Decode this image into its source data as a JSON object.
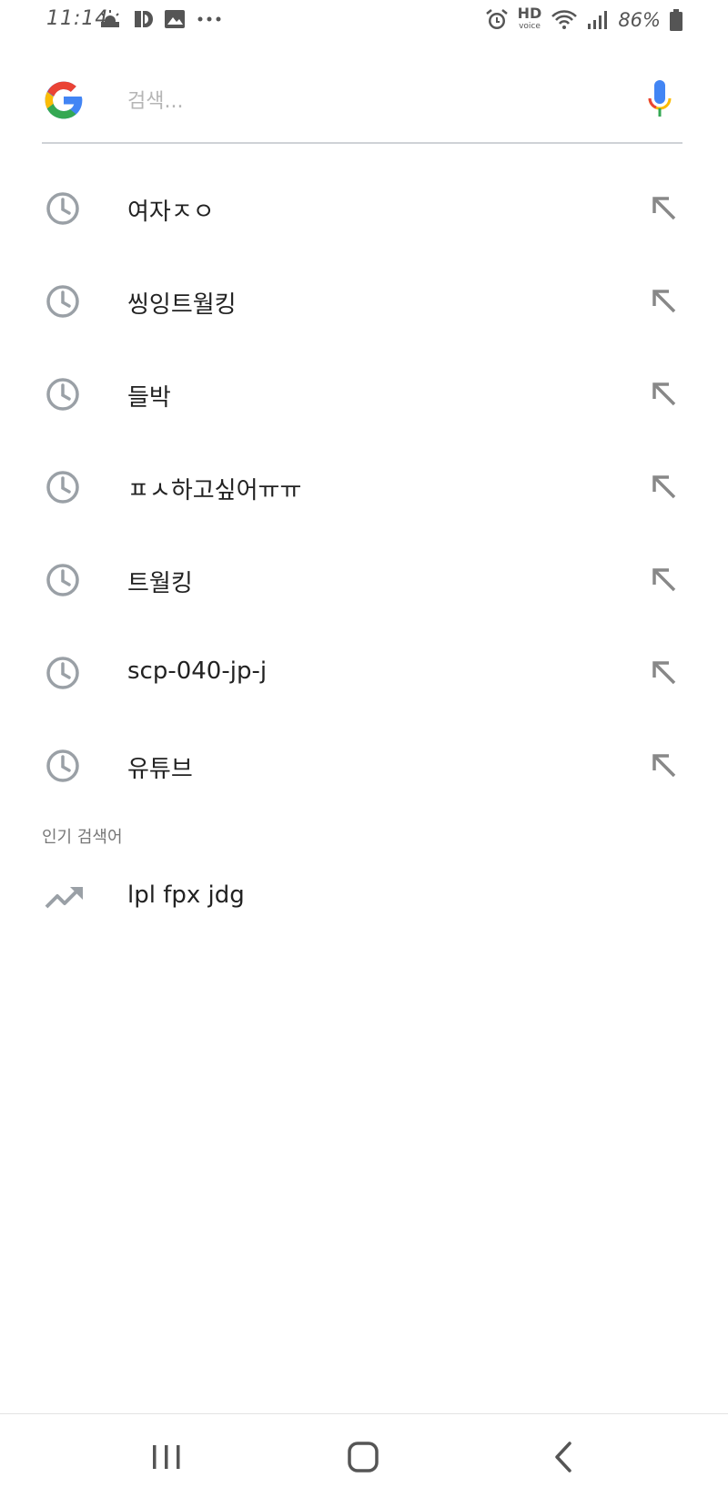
{
  "status_bar": {
    "time": "11:14",
    "left_icons": [
      "weather-icon",
      "app-icon",
      "image-icon",
      "more-dots-icon"
    ],
    "right_icons": [
      "alarm-icon",
      "hd-voice-icon",
      "wifi-icon",
      "signal-icon",
      "battery-icon"
    ],
    "hd_label": "HD",
    "hd_sub": "voice",
    "battery": "86%"
  },
  "search": {
    "placeholder": "검색...",
    "value": ""
  },
  "recent_searches": [
    {
      "label": "여자ㅈㅇ",
      "icon": "history-icon"
    },
    {
      "label": "씽잉트월킹",
      "icon": "history-icon"
    },
    {
      "label": "들박",
      "icon": "history-icon"
    },
    {
      "label": "ㅍㅅ하고싶어ㅠㅠ",
      "icon": "history-icon"
    },
    {
      "label": "트월킹",
      "icon": "history-icon"
    },
    {
      "label": "scp-040-jp-j",
      "icon": "history-icon"
    },
    {
      "label": "유튜브",
      "icon": "history-icon"
    }
  ],
  "trending": {
    "header": "인기 검색어",
    "items": [
      {
        "label": "lpl fpx jdg",
        "icon": "trending-up-icon"
      }
    ]
  },
  "colors": {
    "google_blue": "#4285F4",
    "google_red": "#EA4335",
    "google_yellow": "#FBBC05",
    "google_green": "#34A853",
    "icon_gray": "#9aa0a6"
  }
}
